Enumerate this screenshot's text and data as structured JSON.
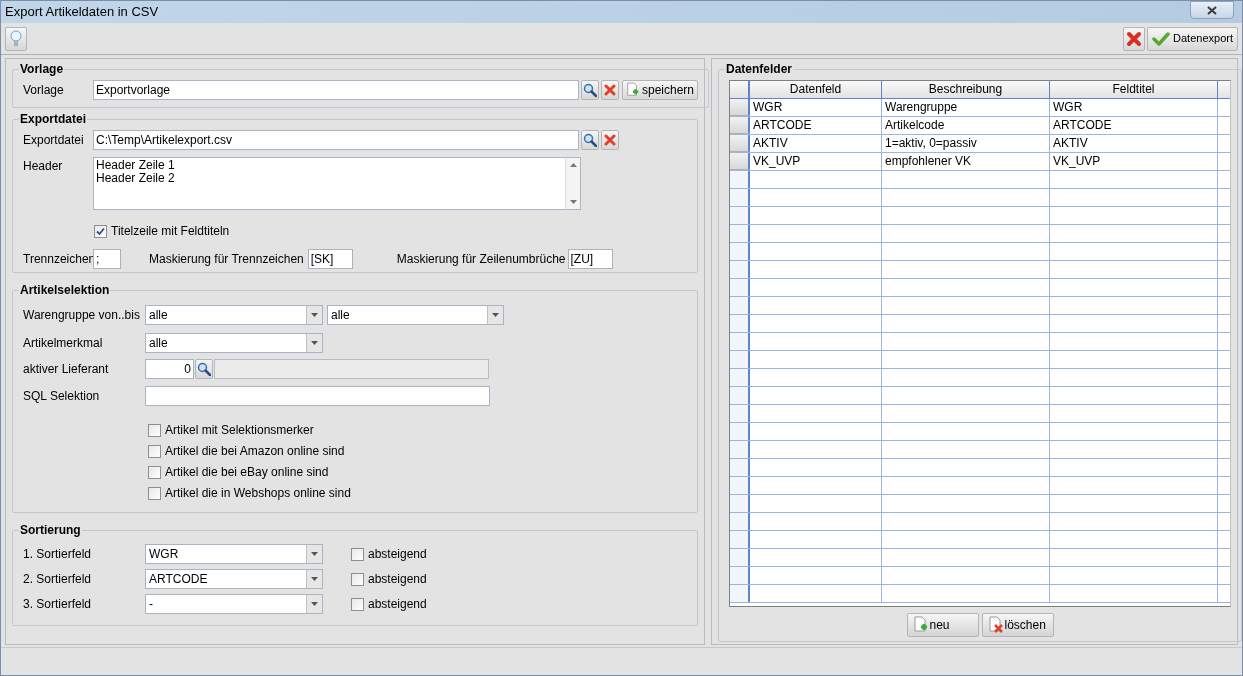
{
  "window": {
    "title": "Export Artikeldaten in CSV"
  },
  "toolbar": {
    "export_button": "Datenexport"
  },
  "vorlage": {
    "title": "Vorlage",
    "label": "Vorlage",
    "value": "Exportvorlage",
    "save_button": "speichern"
  },
  "exportdatei": {
    "title": "Exportdatei",
    "file_label": "Exportdatei",
    "file_value": "C:\\Temp\\Artikelexport.csv",
    "header_label": "Header",
    "header_lines": [
      "Header Zeile 1",
      "Header Zeile 2"
    ],
    "title_row": {
      "label": "Titelzeile mit Feldtiteln",
      "checked": true
    },
    "separator": {
      "label": "Trennzeichen",
      "value": ";"
    },
    "separator_mask": {
      "label": "Maskierung für Trennzeichen",
      "value": "[SK]"
    },
    "linebreak_mask": {
      "label": "Maskierung für Zeilenumbrüche",
      "value": "[ZU]"
    }
  },
  "artikelselektion": {
    "title": "Artikelselektion",
    "warengruppe": {
      "label": "Warengruppe von..bis",
      "from": "alle",
      "to": "alle"
    },
    "artikelmerkmal": {
      "label": "Artikelmerkmal",
      "value": "alle"
    },
    "lieferant": {
      "label": "aktiver Lieferant",
      "value": "0"
    },
    "sql": {
      "label": "SQL Selektion"
    },
    "checkboxes": [
      {
        "label": "Artikel mit Selektionsmerker",
        "checked": false
      },
      {
        "label": "Artikel die bei Amazon online sind",
        "checked": false
      },
      {
        "label": "Artikel die bei eBay online sind",
        "checked": false
      },
      {
        "label": "Artikel die in Webshops online sind",
        "checked": false
      }
    ]
  },
  "sortierung": {
    "title": "Sortierung",
    "rows": [
      {
        "label": "1. Sortierfeld",
        "value": "WGR",
        "descending_label": "absteigend",
        "descending": false
      },
      {
        "label": "2. Sortierfeld",
        "value": "ARTCODE",
        "descending_label": "absteigend",
        "descending": false
      },
      {
        "label": "3. Sortierfeld",
        "value": "-",
        "descending_label": "absteigend",
        "descending": false
      }
    ]
  },
  "datenfelder": {
    "title": "Datenfelder",
    "columns": [
      "Datenfeld",
      "Beschreibung",
      "Feldtitel"
    ],
    "rows": [
      [
        "WGR",
        "Warengruppe",
        "WGR"
      ],
      [
        "ARTCODE",
        "Artikelcode",
        "ARTCODE"
      ],
      [
        "AKTIV",
        "1=aktiv, 0=passiv",
        "AKTIV"
      ],
      [
        "VK_UVP",
        "empfohlener VK",
        "VK_UVP"
      ]
    ],
    "buttons": {
      "new": "neu",
      "delete": "löschen"
    }
  }
}
